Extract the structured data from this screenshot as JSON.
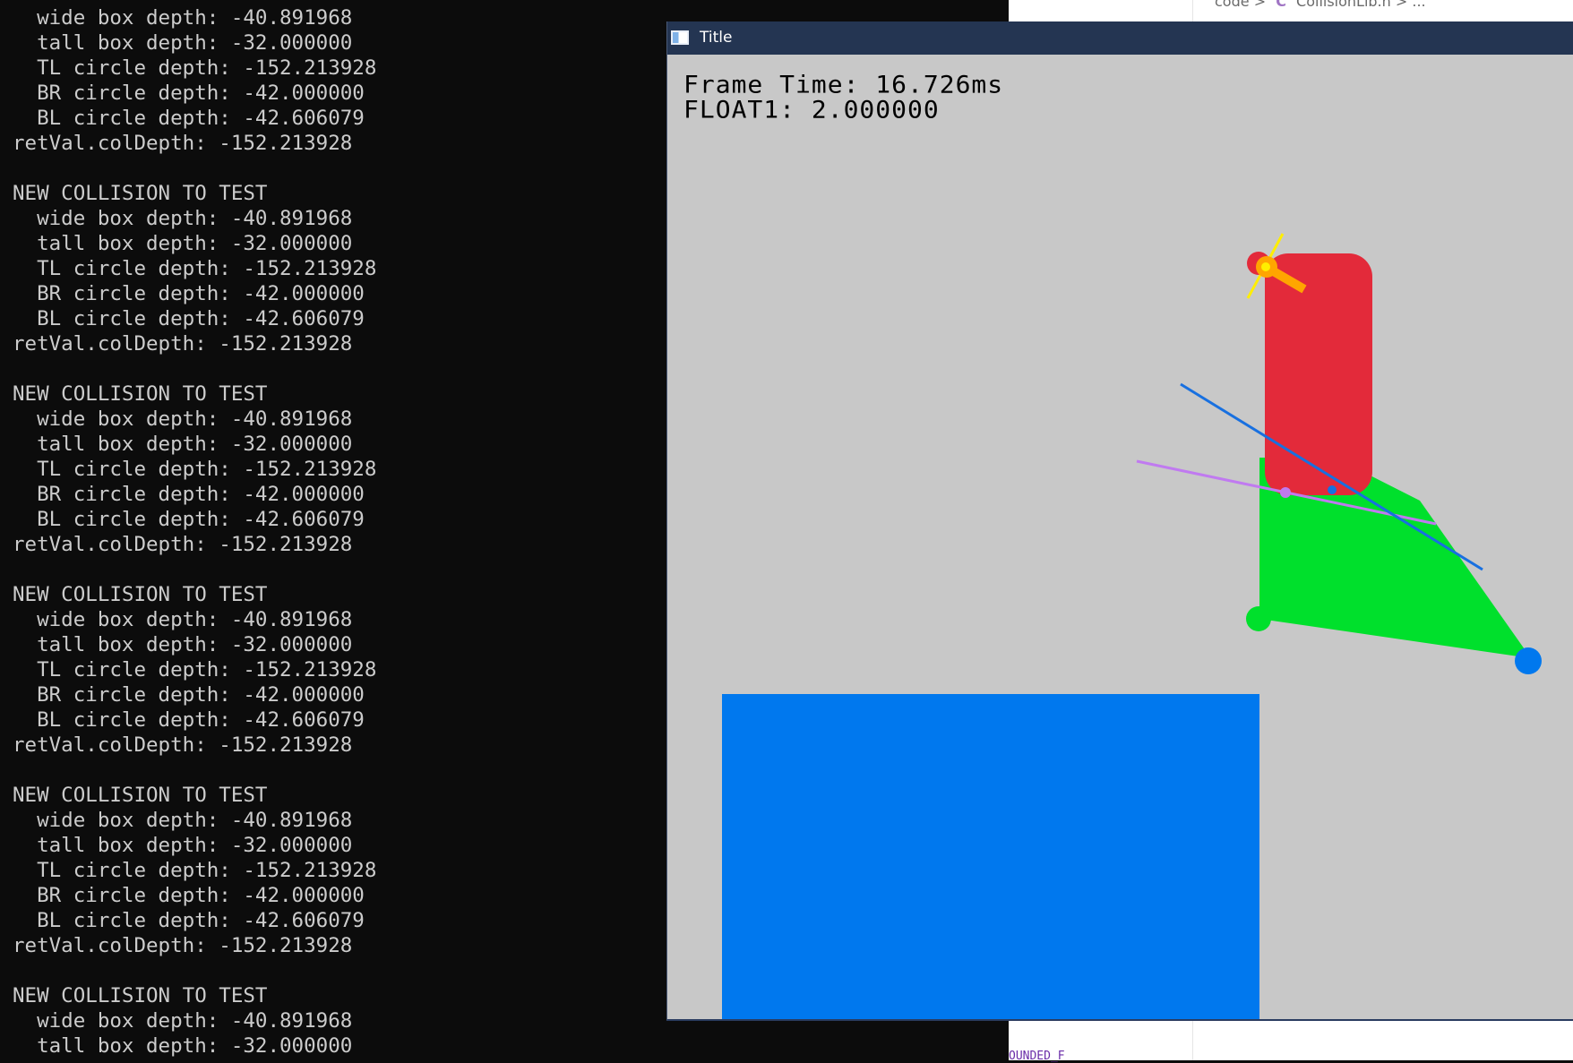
{
  "editor": {
    "breadcrumb_folder": "code",
    "breadcrumb_file": "CollisionLib.h",
    "breadcrumb_more": "...",
    "separator": ">",
    "file_icon_letter": "C",
    "bottom_text": "OUNDED_F"
  },
  "console": {
    "lines": [
      "  wide box depth: -40.891968",
      "  tall box depth: -32.000000",
      "  TL circle depth: -152.213928",
      "  BR circle depth: -42.000000",
      "  BL circle depth: -42.606079",
      "retVal.colDepth: -152.213928",
      "",
      "NEW COLLISION TO TEST",
      "  wide box depth: -40.891968",
      "  tall box depth: -32.000000",
      "  TL circle depth: -152.213928",
      "  BR circle depth: -42.000000",
      "  BL circle depth: -42.606079",
      "retVal.colDepth: -152.213928",
      "",
      "NEW COLLISION TO TEST",
      "  wide box depth: -40.891968",
      "  tall box depth: -32.000000",
      "  TL circle depth: -152.213928",
      "  BR circle depth: -42.000000",
      "  BL circle depth: -42.606079",
      "retVal.colDepth: -152.213928",
      "",
      "NEW COLLISION TO TEST",
      "  wide box depth: -40.891968",
      "  tall box depth: -32.000000",
      "  TL circle depth: -152.213928",
      "  BR circle depth: -42.000000",
      "  BL circle depth: -42.606079",
      "retVal.colDepth: -152.213928",
      "",
      "NEW COLLISION TO TEST",
      "  wide box depth: -40.891968",
      "  tall box depth: -32.000000",
      "  TL circle depth: -152.213928",
      "  BR circle depth: -42.000000",
      "  BL circle depth: -42.606079",
      "retVal.colDepth: -152.213928",
      "",
      "NEW COLLISION TO TEST",
      "  wide box depth: -40.891968",
      "  tall box depth: -32.000000"
    ]
  },
  "game_window": {
    "title": "Title",
    "hud": {
      "frame_time": "Frame Time: 16.726ms",
      "float1": "FLOAT1: 2.000000"
    }
  },
  "colors": {
    "console_bg": "#0c0c0c",
    "console_text": "#cccccc",
    "titlebar_bg": "#243552",
    "game_bg": "#c8c8c8",
    "blue_box": "#0078ee",
    "red_capsule": "#e32a3a",
    "green_triangle": "#00e02c",
    "blue_line": "#1870e0",
    "purple_line": "#c07af0",
    "orange_marker": "#ffa500",
    "yellow_marker": "#ffee00"
  }
}
